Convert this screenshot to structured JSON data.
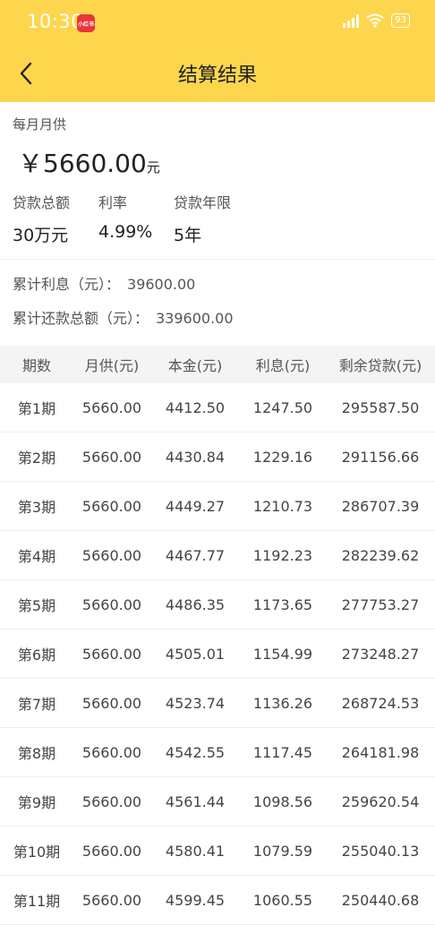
{
  "status_bar": {
    "time": "10:30",
    "app_badge": "小红书",
    "battery": "93"
  },
  "header": {
    "title": "结算结果",
    "back_icon": "chevron-left-icon"
  },
  "summary": {
    "monthly_label": "每月月供",
    "monthly_amount": "￥5660.00",
    "monthly_unit": "元",
    "loan_total_label": "贷款总额",
    "loan_total_value": "30万元",
    "rate_label": "利率",
    "rate_value": "4.99%",
    "term_label": "贷款年限",
    "term_value": "5年"
  },
  "totals": {
    "interest_label": "累计利息（元）：",
    "interest_value": "39600.00",
    "repayment_label": "累计还款总额（元）：",
    "repayment_value": "339600.00"
  },
  "table": {
    "headers": [
      "期数",
      "月供(元)",
      "本金(元)",
      "利息(元)",
      "剩余贷款(元)"
    ],
    "rows": [
      [
        "第1期",
        "5660.00",
        "4412.50",
        "1247.50",
        "295587.50"
      ],
      [
        "第2期",
        "5660.00",
        "4430.84",
        "1229.16",
        "291156.66"
      ],
      [
        "第3期",
        "5660.00",
        "4449.27",
        "1210.73",
        "286707.39"
      ],
      [
        "第4期",
        "5660.00",
        "4467.77",
        "1192.23",
        "282239.62"
      ],
      [
        "第5期",
        "5660.00",
        "4486.35",
        "1173.65",
        "277753.27"
      ],
      [
        "第6期",
        "5660.00",
        "4505.01",
        "1154.99",
        "273248.27"
      ],
      [
        "第7期",
        "5660.00",
        "4523.74",
        "1136.26",
        "268724.53"
      ],
      [
        "第8期",
        "5660.00",
        "4542.55",
        "1117.45",
        "264181.98"
      ],
      [
        "第9期",
        "5660.00",
        "4561.44",
        "1098.56",
        "259620.54"
      ],
      [
        "第10期",
        "5660.00",
        "4580.41",
        "1079.59",
        "255040.13"
      ],
      [
        "第11期",
        "5660.00",
        "4599.45",
        "1060.55",
        "250440.68"
      ]
    ]
  },
  "colors": {
    "header_bg": "#FDD64E",
    "table_header_bg": "#F4F4F4"
  }
}
